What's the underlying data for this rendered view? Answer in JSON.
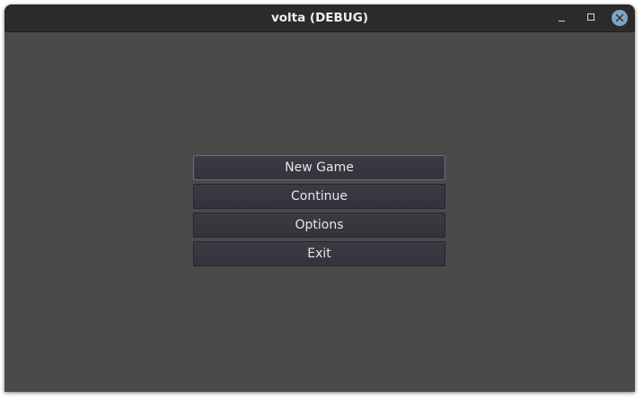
{
  "window": {
    "title": "volta (DEBUG)",
    "controls": [
      "minimize",
      "maximize",
      "close"
    ]
  },
  "menu": {
    "buttons": [
      {
        "label": "New Game",
        "focused": true
      },
      {
        "label": "Continue",
        "focused": false
      },
      {
        "label": "Options",
        "focused": false
      },
      {
        "label": "Exit",
        "focused": false
      }
    ]
  },
  "colors": {
    "background": "#4a4a4a",
    "titlebar": "#2b2b2b",
    "button": "#38363f",
    "focus_border": "#5f728f",
    "close_button": "#7fa3c3"
  }
}
